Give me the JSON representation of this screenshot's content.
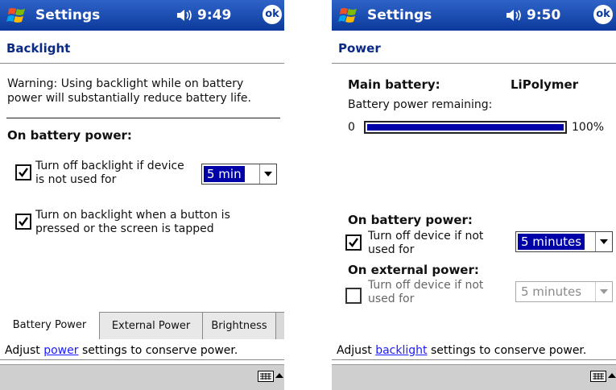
{
  "backlight": {
    "titlebar": {
      "title": "Settings",
      "time": "9:49",
      "ok": "ok"
    },
    "heading": "Backlight",
    "warning_line1": "Warning: Using backlight while on battery",
    "warning_line2": "power will substantially reduce battery life.",
    "section": "On battery power:",
    "option1_line1": "Turn off backlight if device",
    "option1_line2": "is not used for",
    "option1_checked": true,
    "option1_dropdown": "5 min",
    "option2_line1": "Turn on backlight when a button is",
    "option2_line2": "pressed or the screen is tapped",
    "option2_checked": true,
    "tabs": [
      "Battery Power",
      "External Power",
      "Brightness"
    ],
    "active_tab": "Battery Power",
    "help_prefix": "Adjust ",
    "help_link": "power",
    "help_suffix": " settings to conserve power."
  },
  "power": {
    "titlebar": {
      "title": "Settings",
      "time": "9:50",
      "ok": "ok"
    },
    "heading": "Power",
    "main_battery_label": "Main battery:",
    "main_battery_type": "LiPolymer",
    "remaining_label": "Battery power remaining:",
    "bar_min": "0",
    "bar_max": "100%",
    "battery_level": 1.0,
    "battery_section": "On battery power:",
    "battery_option_line1": "Turn off device if not",
    "battery_option_line2": "used for",
    "battery_option_checked": true,
    "battery_dropdown": "5 minutes",
    "external_section": "On external power:",
    "external_option_line1": "Turn off device if not",
    "external_option_line2": "used for",
    "external_option_checked": false,
    "external_dropdown": "5 minutes",
    "help_prefix": "Adjust ",
    "help_link": "backlight",
    "help_suffix": " settings to conserve power."
  },
  "icons": {
    "start": "windows-flag-icon",
    "volume": "speaker-icon",
    "keyboard": "keyboard-icon",
    "sip": "up-arrow-icon"
  },
  "colors": {
    "titlebar": "#0c3a9c",
    "selection": "#0000a8",
    "heading": "#0a2a86",
    "link": "#1a1aff"
  }
}
